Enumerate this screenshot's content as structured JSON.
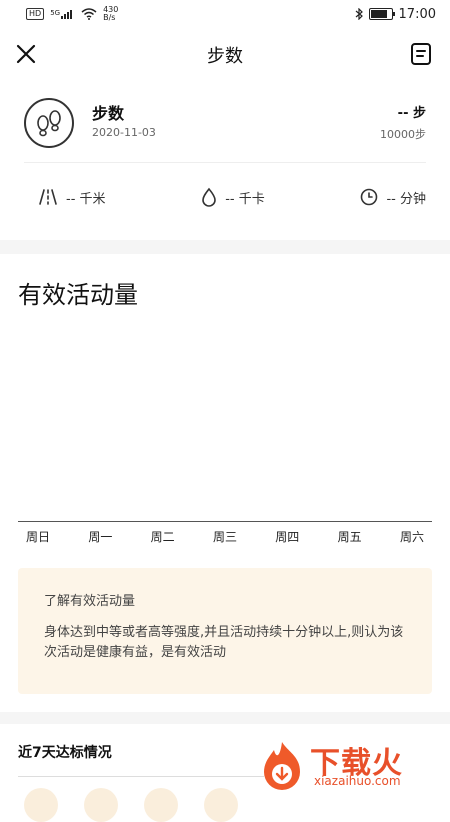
{
  "status_bar": {
    "hd": "HD",
    "signal": "5G",
    "net_speed_value": "430",
    "net_speed_unit": "B/s",
    "battery_level": 0.9,
    "time": "17:00"
  },
  "nav": {
    "title": "步数"
  },
  "summary": {
    "title": "步数",
    "date": "2020-11-03",
    "value": "-- 步",
    "goal": "10000步"
  },
  "metrics": [
    {
      "icon": "distance-icon",
      "label": "-- 千米"
    },
    {
      "icon": "calories-icon",
      "label": "-- 千卡"
    },
    {
      "icon": "clock-icon",
      "label": "-- 分钟"
    }
  ],
  "activity": {
    "title": "有效活动量",
    "days": [
      "周日",
      "周一",
      "周二",
      "周三",
      "周四",
      "周五",
      "周六"
    ]
  },
  "info": {
    "title": "了解有效活动量",
    "body": "身体达到中等或者高等强度,并且活动持续十分钟以上,则认为该次活动是健康有益，是有效活动"
  },
  "weekly": {
    "title": "近7天达标情况"
  },
  "watermark": {
    "name": "下载火",
    "url": "xiazaihuo.com"
  }
}
